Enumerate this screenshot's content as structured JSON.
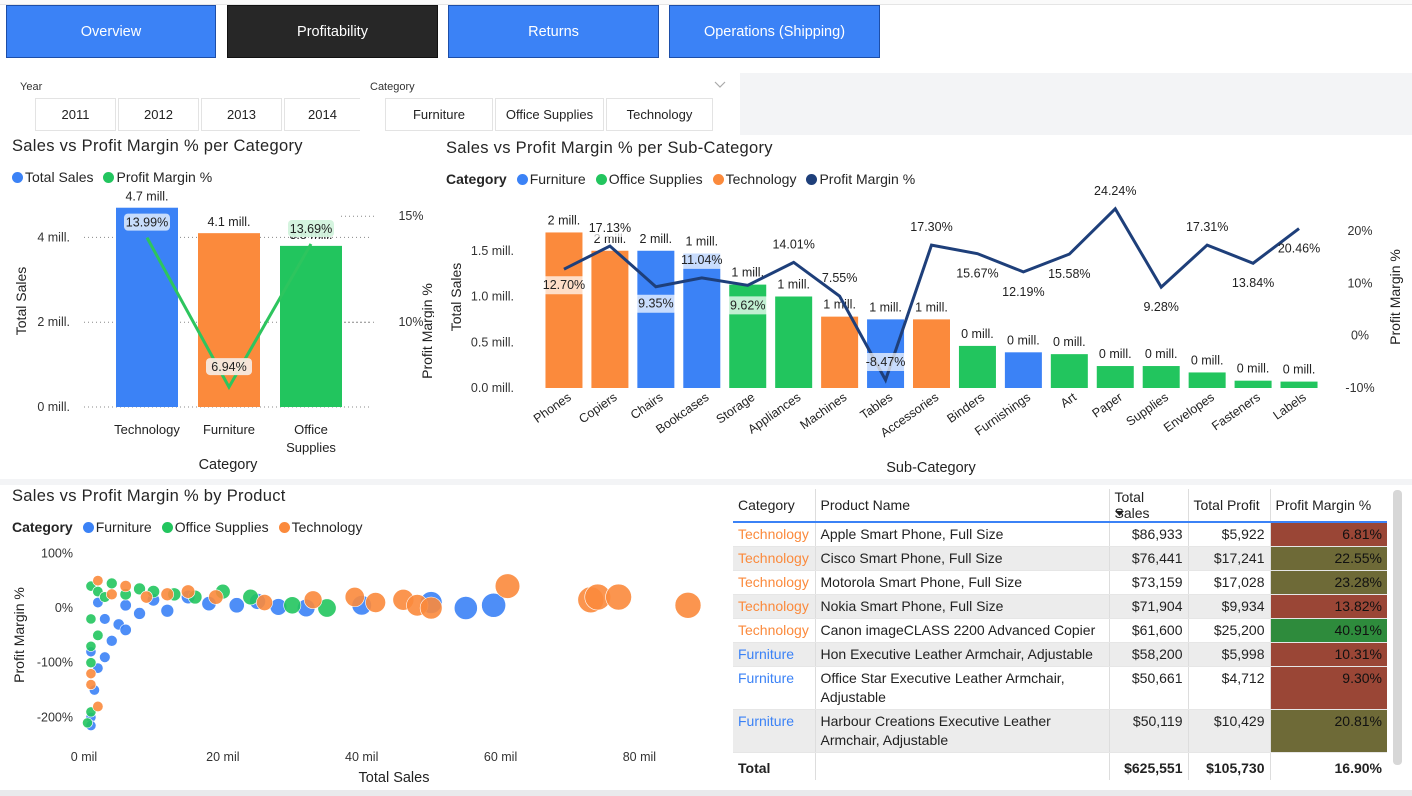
{
  "nav": {
    "tabs": [
      {
        "label": "Overview"
      },
      {
        "label": "Profitability"
      },
      {
        "label": "Returns"
      },
      {
        "label": "Operations (Shipping)"
      }
    ]
  },
  "colors": {
    "furniture": "#3b82f6",
    "office_supplies": "#22c55e",
    "technology": "#fb8a3c",
    "margin_line_category": "#2dc55e",
    "margin_line_sub": "#1e3f7a",
    "nav_active": "#272727",
    "nav_default": "#3b82f6"
  },
  "filters": {
    "year": {
      "title": "Year",
      "options": [
        "2011",
        "2012",
        "2013",
        "2014"
      ]
    },
    "category": {
      "title": "Category",
      "options": [
        "Furniture",
        "Office Supplies",
        "Technology"
      ],
      "chevron": "chevron-down-icon"
    }
  },
  "legend_labels": {
    "total_sales": "Total Sales",
    "profit_margin": "Profit Margin %",
    "category": "Category",
    "furniture": "Furniture",
    "office_supplies": "Office Supplies",
    "technology": "Technology"
  },
  "chart_data": [
    {
      "type": "bar",
      "title": "Sales vs Profit Margin % per Category",
      "xlabel": "Category",
      "ylabel": "Total Sales",
      "y2label": "Profit Margin %",
      "categories": [
        "Technology",
        "Furniture",
        "Office\nSupplies"
      ],
      "series": [
        {
          "name": "Total Sales",
          "kind": "bar",
          "values": [
            4.7,
            4.1,
            3.8
          ],
          "labels": [
            "4.7 mill.",
            "4.1 mill.",
            "3.8 mill."
          ]
        },
        {
          "name": "Profit Margin %",
          "kind": "line",
          "axis": "right",
          "values": [
            13.99,
            6.94,
            13.69
          ],
          "labels": [
            "13.99%",
            "6.94%",
            "13.69%"
          ]
        }
      ],
      "bar_colors": [
        "#fb8a3c",
        "#fb8a3c",
        "#22c55e"
      ],
      "bar_color_first": "#3b82f6",
      "yticks": [
        "0 mill.",
        "2 mill.",
        "4 mill."
      ],
      "ylim": [
        0,
        5
      ],
      "y2ticks": [
        "10%",
        "15%"
      ],
      "y2lim": [
        6,
        16
      ],
      "grid": true
    },
    {
      "type": "bar",
      "title": "Sales vs Profit Margin % per Sub-Category",
      "xlabel": "Sub-Category",
      "ylabel": "Total Sales",
      "y2label": "Profit Margin %",
      "categories": [
        "Phones",
        "Copiers",
        "Chairs",
        "Bookcases",
        "Storage",
        "Appliances",
        "Machines",
        "Tables",
        "Accessories",
        "Binders",
        "Furnishings",
        "Art",
        "Paper",
        "Supplies",
        "Envelopes",
        "Fasteners",
        "Labels"
      ],
      "category_group": [
        "Technology",
        "Technology",
        "Furniture",
        "Furniture",
        "Office Supplies",
        "Office Supplies",
        "Technology",
        "Furniture",
        "Technology",
        "Office Supplies",
        "Furniture",
        "Office Supplies",
        "Office Supplies",
        "Office Supplies",
        "Office Supplies",
        "Office Supplies",
        "Office Supplies"
      ],
      "series": [
        {
          "name": "Total Sales",
          "kind": "bar",
          "values": [
            1.7,
            1.5,
            1.5,
            1.47,
            1.13,
            1.0,
            0.78,
            0.75,
            0.75,
            0.46,
            0.39,
            0.37,
            0.24,
            0.24,
            0.17,
            0.08,
            0.07
          ],
          "labels": [
            "2 mill.",
            "2 mill.",
            "2 mill.",
            "1 mill.",
            "1 mill.",
            "1 mill.",
            "1 mill.",
            "1 mill.",
            "1 mill.",
            "0 mill.",
            "0 mill.",
            "0 mill.",
            "0 mill.",
            "0 mill.",
            "0 mill.",
            "0 mill.",
            "0 mill."
          ]
        },
        {
          "name": "Profit Margin %",
          "kind": "line",
          "axis": "right",
          "values": [
            12.7,
            17.13,
            9.35,
            11.04,
            9.62,
            14.01,
            7.55,
            -8.47,
            17.3,
            15.67,
            12.19,
            15.58,
            24.24,
            9.28,
            17.31,
            13.84,
            20.46
          ],
          "labels": [
            "12.70%",
            "17.13%",
            "9.35%",
            "11.04%",
            "9.62%",
            "14.01%",
            "7.55%",
            "-8.47%",
            "17.30%",
            "15.67%",
            "12.19%",
            "15.58%",
            "24.24%",
            "9.28%",
            "17.31%",
            "13.84%",
            "20.46%"
          ]
        }
      ],
      "yticks": [
        "0.0 mill.",
        "0.5 mill.",
        "1.0 mill.",
        "1.5 mill."
      ],
      "ylim": [
        0,
        2
      ],
      "y2ticks": [
        "-10%",
        "0%",
        "10%",
        "20%"
      ],
      "y2lim": [
        -10,
        20
      ],
      "grid": false
    },
    {
      "type": "scatter",
      "title": "Sales vs Profit Margin % by Product",
      "xlabel": "Total Sales",
      "ylabel": "Profit Margin %",
      "xticks": [
        "0 mil",
        "20 mil",
        "40 mil",
        "60 mil",
        "80 mil"
      ],
      "xlim": [
        0,
        90
      ],
      "yticks": [
        "100%",
        "0%",
        "-100%",
        "-200%"
      ],
      "ylim": [
        -250,
        100
      ],
      "series": [
        {
          "name": "Furniture",
          "points": [
            [
              2,
              10
            ],
            [
              3,
              -20
            ],
            [
              5,
              -30
            ],
            [
              6,
              5
            ],
            [
              8,
              -10
            ],
            [
              10,
              15
            ],
            [
              12,
              -5
            ],
            [
              15,
              20
            ],
            [
              18,
              8
            ],
            [
              22,
              5
            ],
            [
              25,
              12
            ],
            [
              28,
              2
            ],
            [
              32,
              0
            ],
            [
              40,
              5
            ],
            [
              50,
              10
            ],
            [
              55,
              0
            ],
            [
              59,
              5
            ],
            [
              1,
              -80
            ],
            [
              1.5,
              -150
            ],
            [
              1,
              -200
            ],
            [
              1,
              -215
            ],
            [
              2,
              -110
            ],
            [
              4,
              -60
            ],
            [
              6,
              -40
            ],
            [
              3,
              -90
            ]
          ]
        },
        {
          "name": "Office Supplies",
          "points": [
            [
              1,
              40
            ],
            [
              2,
              30
            ],
            [
              3,
              20
            ],
            [
              4,
              45
            ],
            [
              6,
              25
            ],
            [
              8,
              35
            ],
            [
              10,
              30
            ],
            [
              13,
              25
            ],
            [
              16,
              20
            ],
            [
              20,
              30
            ],
            [
              24,
              20
            ],
            [
              30,
              5
            ],
            [
              35,
              0
            ],
            [
              1,
              -20
            ],
            [
              2,
              -50
            ],
            [
              1,
              -70
            ],
            [
              1,
              -100
            ],
            [
              1,
              -190
            ],
            [
              0.5,
              -210
            ]
          ]
        },
        {
          "name": "Technology",
          "points": [
            [
              2,
              50
            ],
            [
              4,
              25
            ],
            [
              6,
              40
            ],
            [
              9,
              20
            ],
            [
              12,
              25
            ],
            [
              15,
              30
            ],
            [
              19,
              20
            ],
            [
              26,
              10
            ],
            [
              33,
              15
            ],
            [
              39,
              20
            ],
            [
              42,
              10
            ],
            [
              46,
              15
            ],
            [
              48,
              5
            ],
            [
              50,
              0
            ],
            [
              61,
              40
            ],
            [
              73,
              15
            ],
            [
              74,
              20
            ],
            [
              77,
              20
            ],
            [
              87,
              5
            ],
            [
              1,
              -140
            ],
            [
              2,
              -180
            ],
            [
              1,
              -120
            ]
          ]
        }
      ],
      "grid": false
    },
    {
      "type": "table",
      "columns": [
        "Category",
        "Product Name",
        "Total Sales",
        "Total Profit",
        "Profit Margin %"
      ],
      "sort_indicator": "sort-desc-icon",
      "rows": [
        {
          "category": "Technology",
          "product": "Apple Smart Phone, Full Size",
          "sales": "$86,933",
          "profit": "$5,922",
          "margin": "6.81%",
          "margin_value": 6.81
        },
        {
          "category": "Technology",
          "product": "Cisco Smart Phone, Full Size",
          "sales": "$76,441",
          "profit": "$17,241",
          "margin": "22.55%",
          "margin_value": 22.55
        },
        {
          "category": "Technology",
          "product": "Motorola Smart Phone, Full Size",
          "sales": "$73,159",
          "profit": "$17,028",
          "margin": "23.28%",
          "margin_value": 23.28
        },
        {
          "category": "Technology",
          "product": "Nokia Smart Phone, Full Size",
          "sales": "$71,904",
          "profit": "$9,934",
          "margin": "13.82%",
          "margin_value": 13.82
        },
        {
          "category": "Technology",
          "product": "Canon imageCLASS 2200 Advanced Copier",
          "sales": "$61,600",
          "profit": "$25,200",
          "margin": "40.91%",
          "margin_value": 40.91
        },
        {
          "category": "Furniture",
          "product": "Hon Executive Leather Armchair, Adjustable",
          "sales": "$58,200",
          "profit": "$5,998",
          "margin": "10.31%",
          "margin_value": 10.31
        },
        {
          "category": "Furniture",
          "product": "Office Star Executive Leather Armchair, Adjustable",
          "sales": "$50,661",
          "profit": "$4,712",
          "margin": "9.30%",
          "margin_value": 9.3
        },
        {
          "category": "Furniture",
          "product": "Harbour Creations Executive Leather Armchair, Adjustable",
          "sales": "$50,119",
          "profit": "$10,429",
          "margin": "20.81%",
          "margin_value": 20.81
        }
      ],
      "total": {
        "label": "Total",
        "sales": "$625,551",
        "profit": "$105,730",
        "margin": "16.90%"
      },
      "margin_colors": {
        "low": "#9a4636",
        "mid": "#6e6a37",
        "high": "#2e8b3c"
      }
    }
  ]
}
